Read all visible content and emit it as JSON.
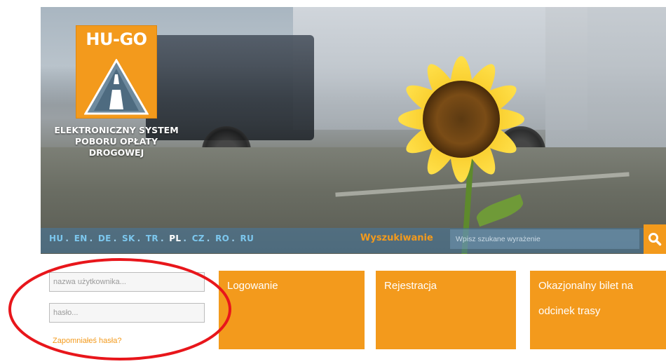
{
  "logo": {
    "title": "HU-GO"
  },
  "system_name": [
    "ELEKTRONICZNY SYSTEM",
    "POBORU OPŁATY",
    "DROGOWEJ"
  ],
  "languages": [
    {
      "code": "HU",
      "active": false
    },
    {
      "code": "EN",
      "active": false
    },
    {
      "code": "DE",
      "active": false
    },
    {
      "code": "SK",
      "active": false
    },
    {
      "code": "TR",
      "active": false
    },
    {
      "code": "PL",
      "active": true
    },
    {
      "code": "CZ",
      "active": false
    },
    {
      "code": "RO",
      "active": false
    },
    {
      "code": "RU",
      "active": false
    }
  ],
  "search": {
    "label": "Wyszukiwanie",
    "placeholder": "Wpisz szukane wyrażenie",
    "icon": "search-icon"
  },
  "login": {
    "username_placeholder": "nazwa użytkownika...",
    "password_placeholder": "hasło...",
    "forgot_link": "Zapomniałeś hasła?"
  },
  "tiles": {
    "login": "Logowanie",
    "register": "Rejestracja",
    "ticket": "Okazjonalny bilet na odcinek trasy"
  },
  "colors": {
    "accent": "#f39a1c",
    "language_link": "#7cc7ee",
    "highlight_oval": "#e8161b"
  }
}
